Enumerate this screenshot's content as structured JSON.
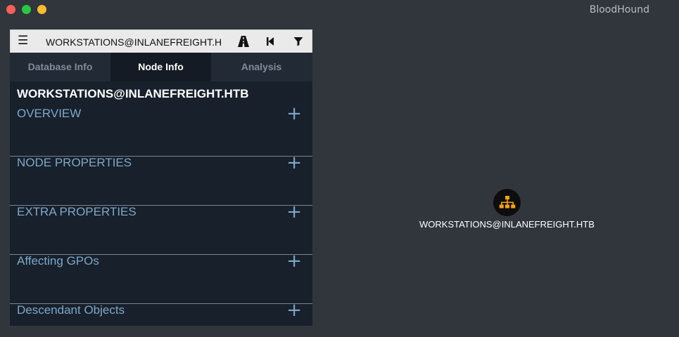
{
  "window": {
    "title": "BloodHound",
    "traffic_lights": [
      {
        "name": "close",
        "color": "#fe5f57"
      },
      {
        "name": "maximize",
        "color": "#28c840"
      },
      {
        "name": "minimize",
        "color": "#febc2e"
      }
    ]
  },
  "search": {
    "value": "WORKSTATIONS@INLANEFREIGHT.H",
    "menu_icon": "hamburger-icon",
    "tools": [
      "pathfinding-road-icon",
      "back-icon",
      "filter-icon"
    ]
  },
  "tabs": [
    {
      "label": "Database Info",
      "active": false
    },
    {
      "label": "Node Info",
      "active": true
    },
    {
      "label": "Analysis",
      "active": false
    }
  ],
  "node_info": {
    "title": "WORKSTATIONS@INLANEFREIGHT.HTB",
    "sections": [
      {
        "label": "OVERVIEW"
      },
      {
        "label": "NODE PROPERTIES"
      },
      {
        "label": "EXTRA PROPERTIES"
      },
      {
        "label": "Affecting GPOs"
      },
      {
        "label": "Descendant Objects"
      }
    ],
    "expand_symbol": "+"
  },
  "graph": {
    "node_label": "WORKSTATIONS@INLANEFREIGHT.HTB",
    "node_icon": "ou-sitemap-icon",
    "node_icon_color": "#f5a50a"
  },
  "colors": {
    "background": "#31363d",
    "panel": "#17202b",
    "accent_text": "#7ea8c9"
  }
}
